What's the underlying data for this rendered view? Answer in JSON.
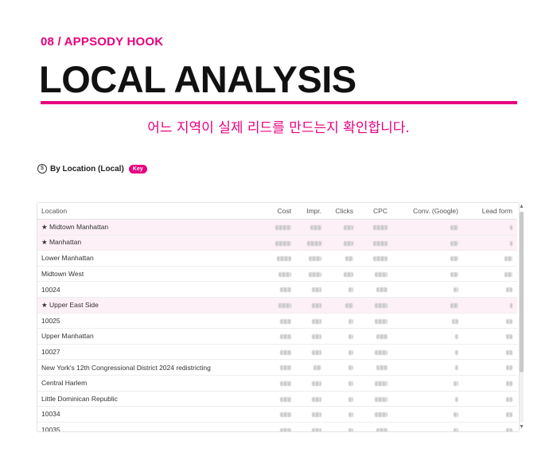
{
  "header": {
    "eyebrow": "08 / APPSODY HOOK",
    "title": "LOCAL ANALYSIS",
    "subtitle": "어느 지역이 실제 리드를 만드는지 확인합니다."
  },
  "section": {
    "icon": "dollar-circle-icon",
    "icon_glyph": "$",
    "label": "By Location (Local)",
    "badge": "Key"
  },
  "colors": {
    "accent": "#e6007e",
    "highlight_row": "#fdf0f6"
  },
  "table": {
    "columns": [
      "Location",
      "Cost",
      "Impr.",
      "Clicks",
      "CPC",
      "Conv. (Google)",
      "Lead form"
    ],
    "rows": [
      {
        "location": "★ Midtown Manhattan",
        "highlight": true
      },
      {
        "location": "★ Manhattan",
        "highlight": true
      },
      {
        "location": "Lower Manhattan",
        "highlight": false
      },
      {
        "location": "Midtown West",
        "highlight": false
      },
      {
        "location": "10024",
        "highlight": false
      },
      {
        "location": "★ Upper East Side",
        "highlight": true
      },
      {
        "location": "10025",
        "highlight": false
      },
      {
        "location": "Upper Manhattan",
        "highlight": false
      },
      {
        "location": "10027",
        "highlight": false
      },
      {
        "location": "New York's 12th Congressional District 2024 redistricting",
        "highlight": false
      },
      {
        "location": "Central Harlem",
        "highlight": false
      },
      {
        "location": "Little Dominican Republic",
        "highlight": false
      },
      {
        "location": "10034",
        "highlight": false
      },
      {
        "location": "10035",
        "highlight": false
      }
    ]
  },
  "scrollbar": {
    "up_icon": "arrow-up-icon",
    "down_icon": "arrow-down-icon",
    "up_glyph": "▲",
    "down_glyph": "▼"
  }
}
